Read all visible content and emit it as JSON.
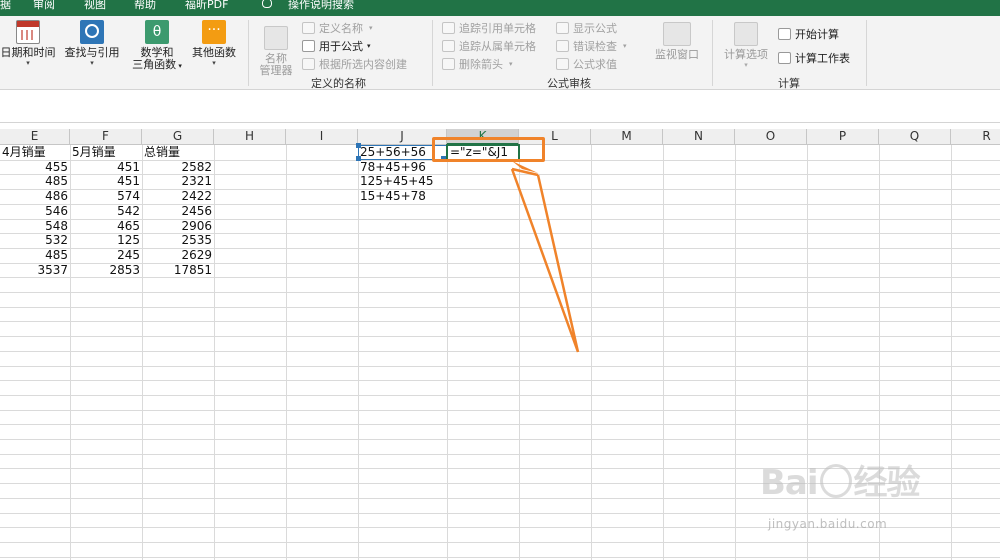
{
  "menubar": {
    "tabs": [
      "据",
      "审阅",
      "视图",
      "帮助",
      "福昕PDF"
    ],
    "search_label": "操作说明搜索"
  },
  "ribbon": {
    "function_library": {
      "buttons": [
        {
          "label1": "日期和时间",
          "label2": "",
          "icon": "calendar-icon"
        },
        {
          "label1": "查找与引用",
          "label2": "",
          "icon": "lookup-icon"
        },
        {
          "label1": "数学和",
          "label2": "三角函数",
          "icon": "math-trig-icon",
          "glyph": "θ"
        },
        {
          "label1": "其他函数",
          "label2": "",
          "icon": "more-functions-icon",
          "glyph": "···"
        }
      ]
    },
    "defined_names": {
      "name_manager_label1": "名称",
      "name_manager_label2": "管理器",
      "define_name": "定义名称",
      "use_in_formula": "用于公式",
      "create_from_selection": "根据所选内容创建",
      "group_label": "定义的名称"
    },
    "formula_auditing": {
      "trace_precedents": "追踪引用单元格",
      "trace_dependents": "追踪从属单元格",
      "remove_arrows": "删除箭头",
      "show_formulas": "显示公式",
      "error_checking": "错误检查",
      "evaluate_formula": "公式求值",
      "watch_window": "监视窗口",
      "group_label": "公式审核"
    },
    "calculation": {
      "calc_options": "计算选项",
      "calc_now": "开始计算",
      "calc_sheet": "计算工作表",
      "group_label": "计算"
    }
  },
  "sheet": {
    "columns": [
      "E",
      "F",
      "G",
      "H",
      "I",
      "J",
      "K",
      "L",
      "M",
      "N",
      "O",
      "P",
      "Q",
      "R"
    ],
    "active_column": "K",
    "headers": [
      "4月销量",
      "5月销量",
      "总销量"
    ],
    "rows": [
      [
        455,
        451,
        2582
      ],
      [
        485,
        451,
        2321
      ],
      [
        486,
        574,
        2422
      ],
      [
        546,
        542,
        2456
      ],
      [
        548,
        465,
        2906
      ],
      [
        532,
        125,
        2535
      ],
      [
        485,
        245,
        2629
      ],
      [
        3537,
        2853,
        17851
      ]
    ],
    "j_values": [
      "25+56+56",
      "78+45+96",
      "125+45+45",
      "15+45+78"
    ],
    "active_formula": "=\"z=\"&J1"
  },
  "watermark": {
    "brand_left": "Bai",
    "brand_right": "经验",
    "url": "jingyan.baidu.com"
  },
  "colors": {
    "accent_green": "#217346",
    "highlight_orange": "#f0832a",
    "ref_blue": "#2e75b6"
  }
}
